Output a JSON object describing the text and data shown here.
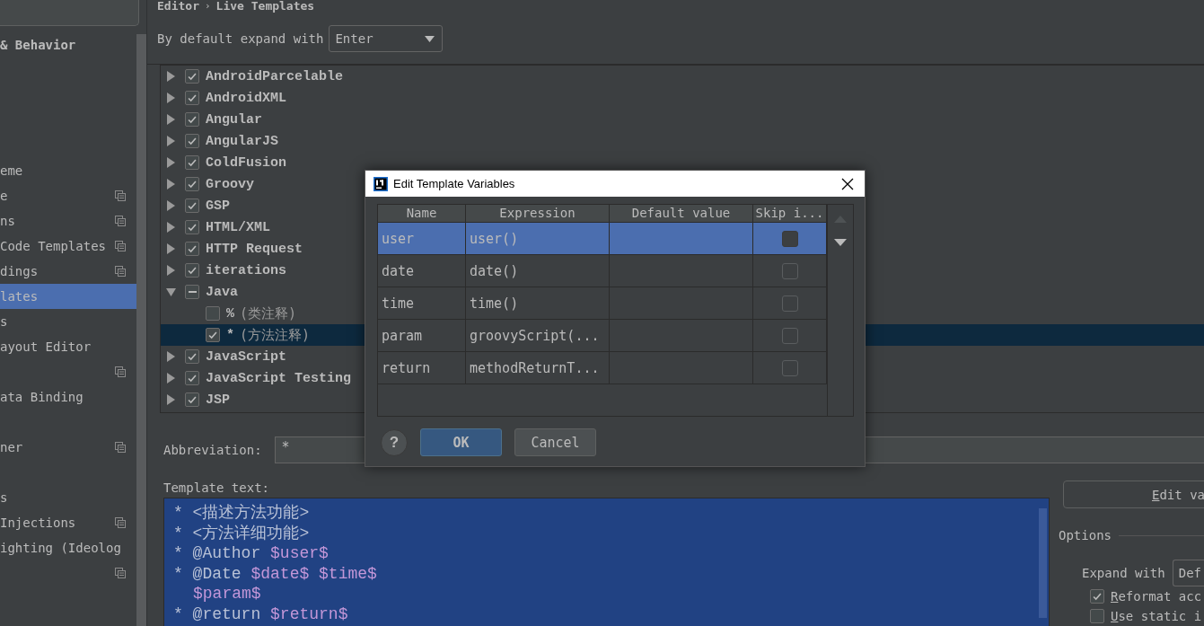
{
  "sidebar": {
    "items": [
      {
        "kind": "header",
        "label": "& Behavior",
        "selected": false,
        "copy_icon": false
      },
      {
        "kind": "blank"
      },
      {
        "kind": "blank"
      },
      {
        "kind": "blank"
      },
      {
        "kind": "blank"
      },
      {
        "kind": "item",
        "label": "eme",
        "selected": false,
        "copy_icon": false
      },
      {
        "kind": "item",
        "label": "e",
        "selected": false,
        "copy_icon": true
      },
      {
        "kind": "item",
        "label": "ns",
        "selected": false,
        "copy_icon": true
      },
      {
        "kind": "item",
        "label": "Code Templates",
        "selected": false,
        "copy_icon": true
      },
      {
        "kind": "item",
        "label": "dings",
        "selected": false,
        "copy_icon": true
      },
      {
        "kind": "item",
        "label": "lates",
        "selected": true,
        "copy_icon": false
      },
      {
        "kind": "item",
        "label": "s",
        "selected": false,
        "copy_icon": false
      },
      {
        "kind": "item",
        "label": "ayout Editor",
        "selected": false,
        "copy_icon": false
      },
      {
        "kind": "item",
        "selected": false,
        "copy_icon": true
      },
      {
        "kind": "item",
        "label": "ata Binding",
        "selected": false,
        "copy_icon": false
      },
      {
        "kind": "blank"
      },
      {
        "kind": "item",
        "label": "ner",
        "selected": false,
        "copy_icon": true
      },
      {
        "kind": "blank"
      },
      {
        "kind": "item",
        "label": "s",
        "selected": false,
        "copy_icon": false
      },
      {
        "kind": "item",
        "label": "Injections",
        "selected": false,
        "copy_icon": true
      },
      {
        "kind": "item",
        "label": "ighting (Ideolog",
        "selected": false,
        "copy_icon": false
      },
      {
        "kind": "item",
        "selected": false,
        "copy_icon": true
      }
    ]
  },
  "breadcrumb": {
    "items": [
      "Editor",
      "Live Templates"
    ],
    "separator": "›"
  },
  "expand_default": {
    "label": "By default expand with",
    "value": "Enter"
  },
  "tree": {
    "groups": [
      {
        "name": "AndroidParcelable",
        "expanded": false,
        "checked": true,
        "partial": false
      },
      {
        "name": "AndroidXML",
        "expanded": false,
        "checked": true,
        "partial": false
      },
      {
        "name": "Angular",
        "expanded": false,
        "checked": true,
        "partial": false
      },
      {
        "name": "AngularJS",
        "expanded": false,
        "checked": true,
        "partial": false
      },
      {
        "name": "ColdFusion",
        "expanded": false,
        "checked": true,
        "partial": false
      },
      {
        "name": "Groovy",
        "expanded": false,
        "checked": true,
        "partial": false
      },
      {
        "name": "GSP",
        "expanded": false,
        "checked": true,
        "partial": false
      },
      {
        "name": "HTML/XML",
        "expanded": false,
        "checked": true,
        "partial": false
      },
      {
        "name": "HTTP Request",
        "expanded": false,
        "checked": true,
        "partial": false
      },
      {
        "name": "iterations",
        "expanded": false,
        "checked": true,
        "partial": false
      },
      {
        "name": "Java",
        "expanded": true,
        "checked": false,
        "partial": true,
        "children": [
          {
            "abbreviation": "%",
            "description": "(类注释)",
            "checked": false,
            "selected": false
          },
          {
            "abbreviation": "*",
            "description": "(方法注释)",
            "checked": true,
            "selected": true
          }
        ]
      },
      {
        "name": "JavaScript",
        "expanded": false,
        "checked": true,
        "partial": false
      },
      {
        "name": "JavaScript Testing",
        "expanded": false,
        "checked": true,
        "partial": false
      },
      {
        "name": "JSP",
        "expanded": false,
        "checked": true,
        "partial": false
      }
    ]
  },
  "abbreviation": {
    "label": "Abbreviation:",
    "value": "*"
  },
  "template_text": {
    "label": "Template text:",
    "lines": [
      {
        "indented": false,
        "segments": [
          {
            "kind": "plain",
            "text": "* <描述方法功能>"
          }
        ]
      },
      {
        "indented": false,
        "segments": [
          {
            "kind": "plain",
            "text": "* <方法详细功能>"
          }
        ]
      },
      {
        "indented": false,
        "segments": [
          {
            "kind": "plain",
            "text": "* @Author "
          },
          {
            "kind": "variable",
            "text": "$user$"
          }
        ]
      },
      {
        "indented": false,
        "segments": [
          {
            "kind": "plain",
            "text": "* @Date "
          },
          {
            "kind": "variable",
            "text": "$date$"
          },
          {
            "kind": "variable",
            "text": " $time$"
          }
        ]
      },
      {
        "indented": true,
        "segments": [
          {
            "kind": "variable",
            "text": "$param$"
          }
        ]
      },
      {
        "indented": false,
        "segments": [
          {
            "kind": "plain",
            "text": "* @return "
          },
          {
            "kind": "variable",
            "text": "$return$"
          }
        ]
      }
    ]
  },
  "edit_variables_button": "Edit va",
  "options": {
    "title": "Options",
    "expand_with": {
      "label": "Expand with",
      "value": "Def"
    },
    "checkboxes": [
      {
        "label": "Reformat acc",
        "checked": true
      },
      {
        "label": "Use static i",
        "checked": false
      }
    ]
  },
  "dialog": {
    "title": "Edit Template Variables",
    "columns": [
      "Name",
      "Expression",
      "Default value",
      "Skip i..."
    ],
    "rows": [
      {
        "name": "user",
        "expression": "user()",
        "skip": false,
        "selected": true
      },
      {
        "name": "date",
        "expression": "date()",
        "skip": false,
        "selected": false
      },
      {
        "name": "time",
        "expression": "time()",
        "skip": false,
        "selected": false
      },
      {
        "name": "param",
        "expression": "groovyScript(...",
        "skip": false,
        "selected": false
      },
      {
        "name": "return",
        "expression": "methodReturnT...",
        "skip": false,
        "selected": false
      }
    ],
    "help": "?",
    "buttons": [
      {
        "label": "OK",
        "default": true
      },
      {
        "label": "Cancel",
        "default": false
      }
    ]
  }
}
